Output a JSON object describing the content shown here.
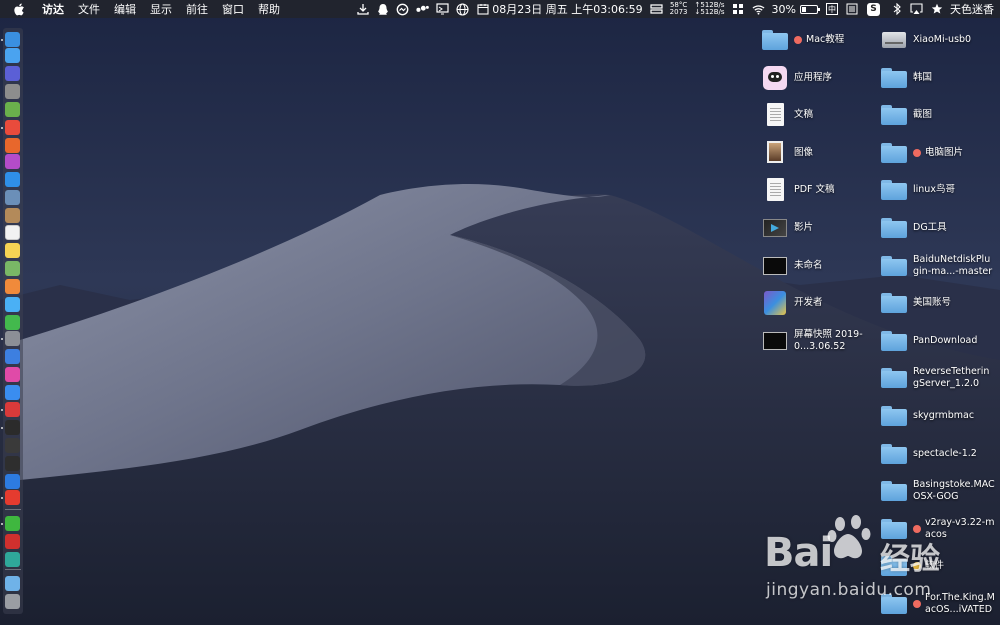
{
  "menubar": {
    "app_name": "访达",
    "menus": [
      "文件",
      "编辑",
      "显示",
      "前往",
      "窗口",
      "帮助"
    ],
    "datetime": "08月23日 周五 上午03:06:59",
    "cpu_temp": "58°C",
    "fan_rpm": "2073",
    "net_up": "↑512B/s",
    "net_down": "↓512B/s",
    "battery_percent": "30%",
    "battery_level": 0.3,
    "input_method": "中",
    "sogou_label": "S",
    "user_name": "天色迷香"
  },
  "desktop": {
    "left_column": [
      {
        "label": "Mac教程",
        "icon": "folder",
        "tag": "red"
      },
      {
        "label": "应用程序",
        "icon": "applications-icon"
      },
      {
        "label": "文稿",
        "icon": "document"
      },
      {
        "label": "图像",
        "icon": "picture"
      },
      {
        "label": "PDF 文稿",
        "icon": "document"
      },
      {
        "label": "影片",
        "icon": "movie"
      },
      {
        "label": "未命名",
        "icon": "screenshot"
      },
      {
        "label": "开发者",
        "icon": "developer"
      },
      {
        "label": "屏幕快照 2019-0...3.06.52",
        "icon": "screenshot"
      }
    ],
    "right_column": [
      {
        "label": "XiaoMi-usb0",
        "icon": "drive"
      },
      {
        "label": "韩国",
        "icon": "folder"
      },
      {
        "label": "截图",
        "icon": "folder"
      },
      {
        "label": "电脑图片",
        "icon": "folder",
        "tag": "red"
      },
      {
        "label": "linux鸟哥",
        "icon": "folder"
      },
      {
        "label": "DG工具",
        "icon": "folder"
      },
      {
        "label": "BaiduNetdiskPlugin-ma...-master",
        "icon": "folder"
      },
      {
        "label": "美国账号",
        "icon": "folder"
      },
      {
        "label": "PanDownload",
        "icon": "folder"
      },
      {
        "label": "ReverseTetheringServer_1.2.0",
        "icon": "folder"
      },
      {
        "label": "skygrmbmac",
        "icon": "folder"
      },
      {
        "label": "spectacle-1.2",
        "icon": "folder"
      },
      {
        "label": "Basingstoke.MACOSX-GOG",
        "icon": "folder"
      },
      {
        "label": "v2ray-v3.22-macos",
        "icon": "folder",
        "tag": "red"
      },
      {
        "label": "软件",
        "icon": "folder",
        "tag": "yellow"
      },
      {
        "label": "For.The.King.MacOS...iVATED",
        "icon": "folder",
        "tag": "red"
      }
    ]
  },
  "watermark": {
    "logo_text": "Bai",
    "logo_text2": "经验",
    "url": "jingyan.baidu.com"
  },
  "colors": {
    "tag_red": "#ef6b60",
    "tag_yellow": "#f5c342",
    "folder_blue": "#6fb2e8"
  }
}
